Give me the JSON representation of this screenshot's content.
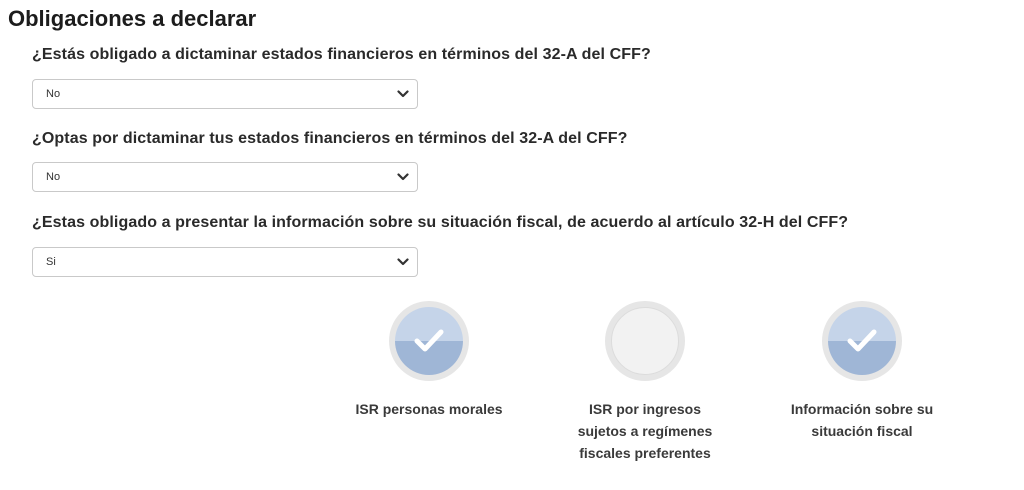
{
  "page": {
    "title": "Obligaciones a declarar"
  },
  "questions": [
    {
      "label": "¿Estás obligado a dictaminar estados financieros en términos del 32-A del CFF?",
      "selected": "No"
    },
    {
      "label": "¿Optas por dictaminar tus estados financieros en términos del 32-A del CFF?",
      "selected": "No"
    },
    {
      "label": "¿Estas obligado a presentar la información sobre su situación fiscal, de acuerdo al artículo 32-H del CFF?",
      "selected": "Si"
    }
  ],
  "obligations": [
    {
      "label_lines": [
        "ISR personas morales"
      ],
      "checked": true,
      "icon": "check-icon"
    },
    {
      "label_lines": [
        "ISR por ingresos",
        "sujetos a regímenes",
        "fiscales preferentes"
      ],
      "checked": false,
      "icon": "empty-circle-icon"
    },
    {
      "label_lines": [
        "Información sobre su",
        "situación fiscal"
      ],
      "checked": true,
      "icon": "check-icon"
    }
  ],
  "colors": {
    "check_top": "#c5d4e9",
    "check_bottom": "#9fb6d6",
    "ring": "#e6e6e6",
    "text": "#1a1a1a"
  }
}
